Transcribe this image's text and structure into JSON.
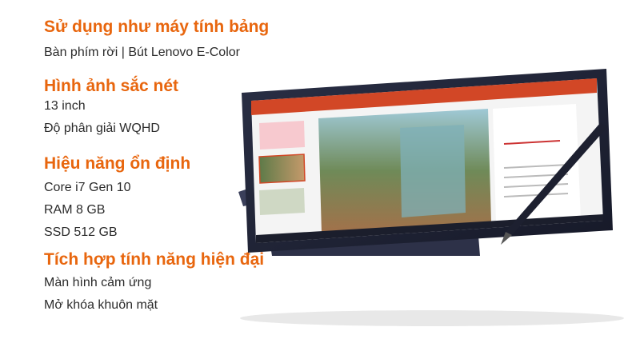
{
  "features": [
    {
      "heading": "Sử dụng như máy tính bảng",
      "lines": [
        "Bàn phím rời | Bút Lenovo E-Color"
      ]
    },
    {
      "heading": "Hình ảnh sắc nét",
      "lines": [
        "13 inch",
        "Độ phân giải WQHD"
      ]
    },
    {
      "heading": "Hiệu năng ổn định",
      "lines": [
        "Core i7 Gen 10",
        "RAM 8 GB",
        "SSD 512 GB"
      ]
    },
    {
      "heading": "Tích hợp tính năng hiện đại",
      "lines": [
        "Màn hình cảm ứng",
        "Mở khóa khuôn mặt"
      ]
    }
  ],
  "image": {
    "subject": "tablet-with-stylus",
    "colors": {
      "heading": "#e8660e",
      "body_text": "#2b2b2b",
      "ribbon": "#d24726",
      "bezel": "#1f2333"
    }
  }
}
